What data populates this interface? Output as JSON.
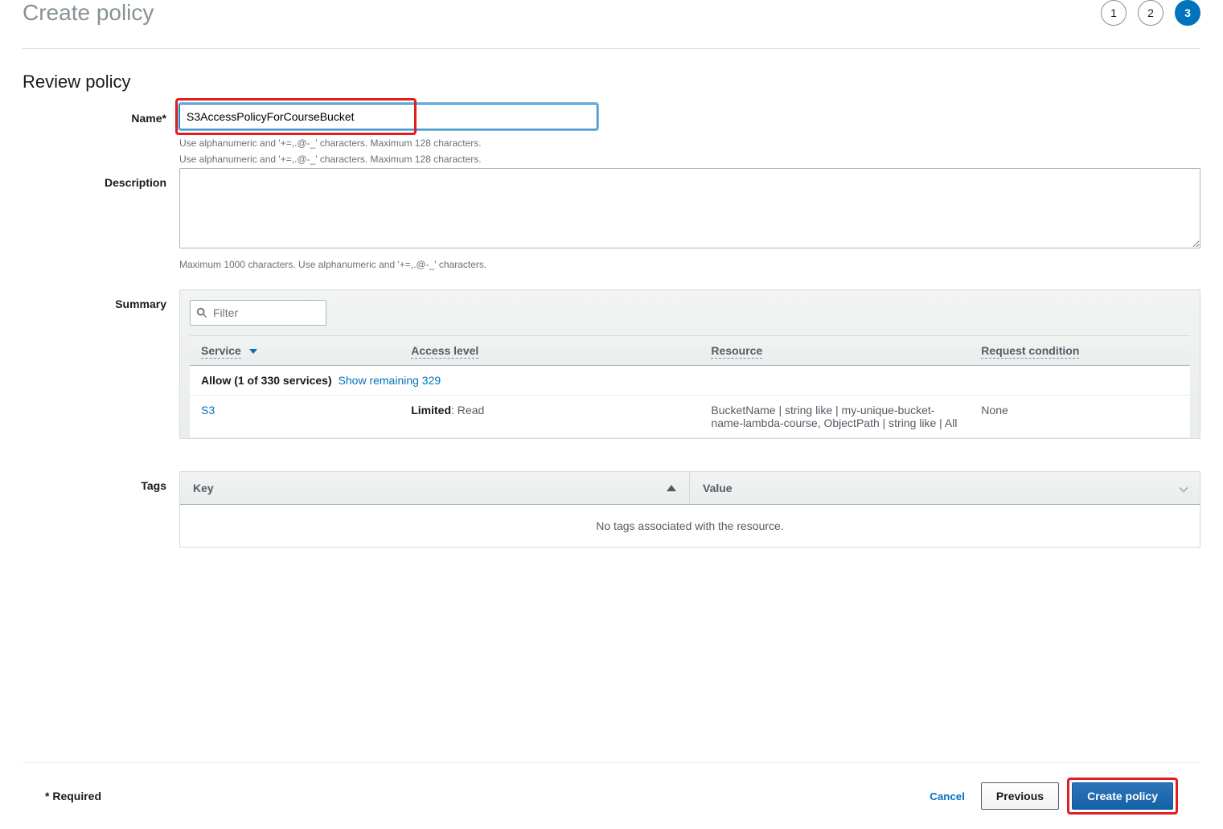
{
  "header": {
    "title": "Create policy"
  },
  "steps": [
    {
      "num": "1",
      "active": false
    },
    {
      "num": "2",
      "active": false
    },
    {
      "num": "3",
      "active": true
    }
  ],
  "review": {
    "title": "Review policy",
    "name_label": "Name*",
    "name_value": "S3AccessPolicyForCourseBucket",
    "name_hint": "Use alphanumeric and '+=,.@-_' characters. Maximum 128 characters.",
    "desc_label": "Description",
    "desc_value": "",
    "desc_hint": "Maximum 1000 characters. Use alphanumeric and '+=,.@-_' characters.",
    "summary_label": "Summary",
    "filter_placeholder": "Filter",
    "columns": {
      "service": "Service",
      "access": "Access level",
      "resource": "Resource",
      "condition": "Request condition"
    },
    "group": {
      "allow_text": "Allow (1 of 330 services)",
      "show_remaining": "Show remaining 329"
    },
    "row": {
      "service": "S3",
      "access_prefix": "Limited",
      "access_suffix": ": Read",
      "resource": "BucketName | string like | my-unique-bucket-name-lambda-course, ObjectPath | string like | All",
      "condition": "None"
    },
    "tags_label": "Tags",
    "tags_key": "Key",
    "tags_value": "Value",
    "tags_empty": "No tags associated with the resource."
  },
  "footer": {
    "required": "* Required",
    "cancel": "Cancel",
    "previous": "Previous",
    "create": "Create policy"
  }
}
